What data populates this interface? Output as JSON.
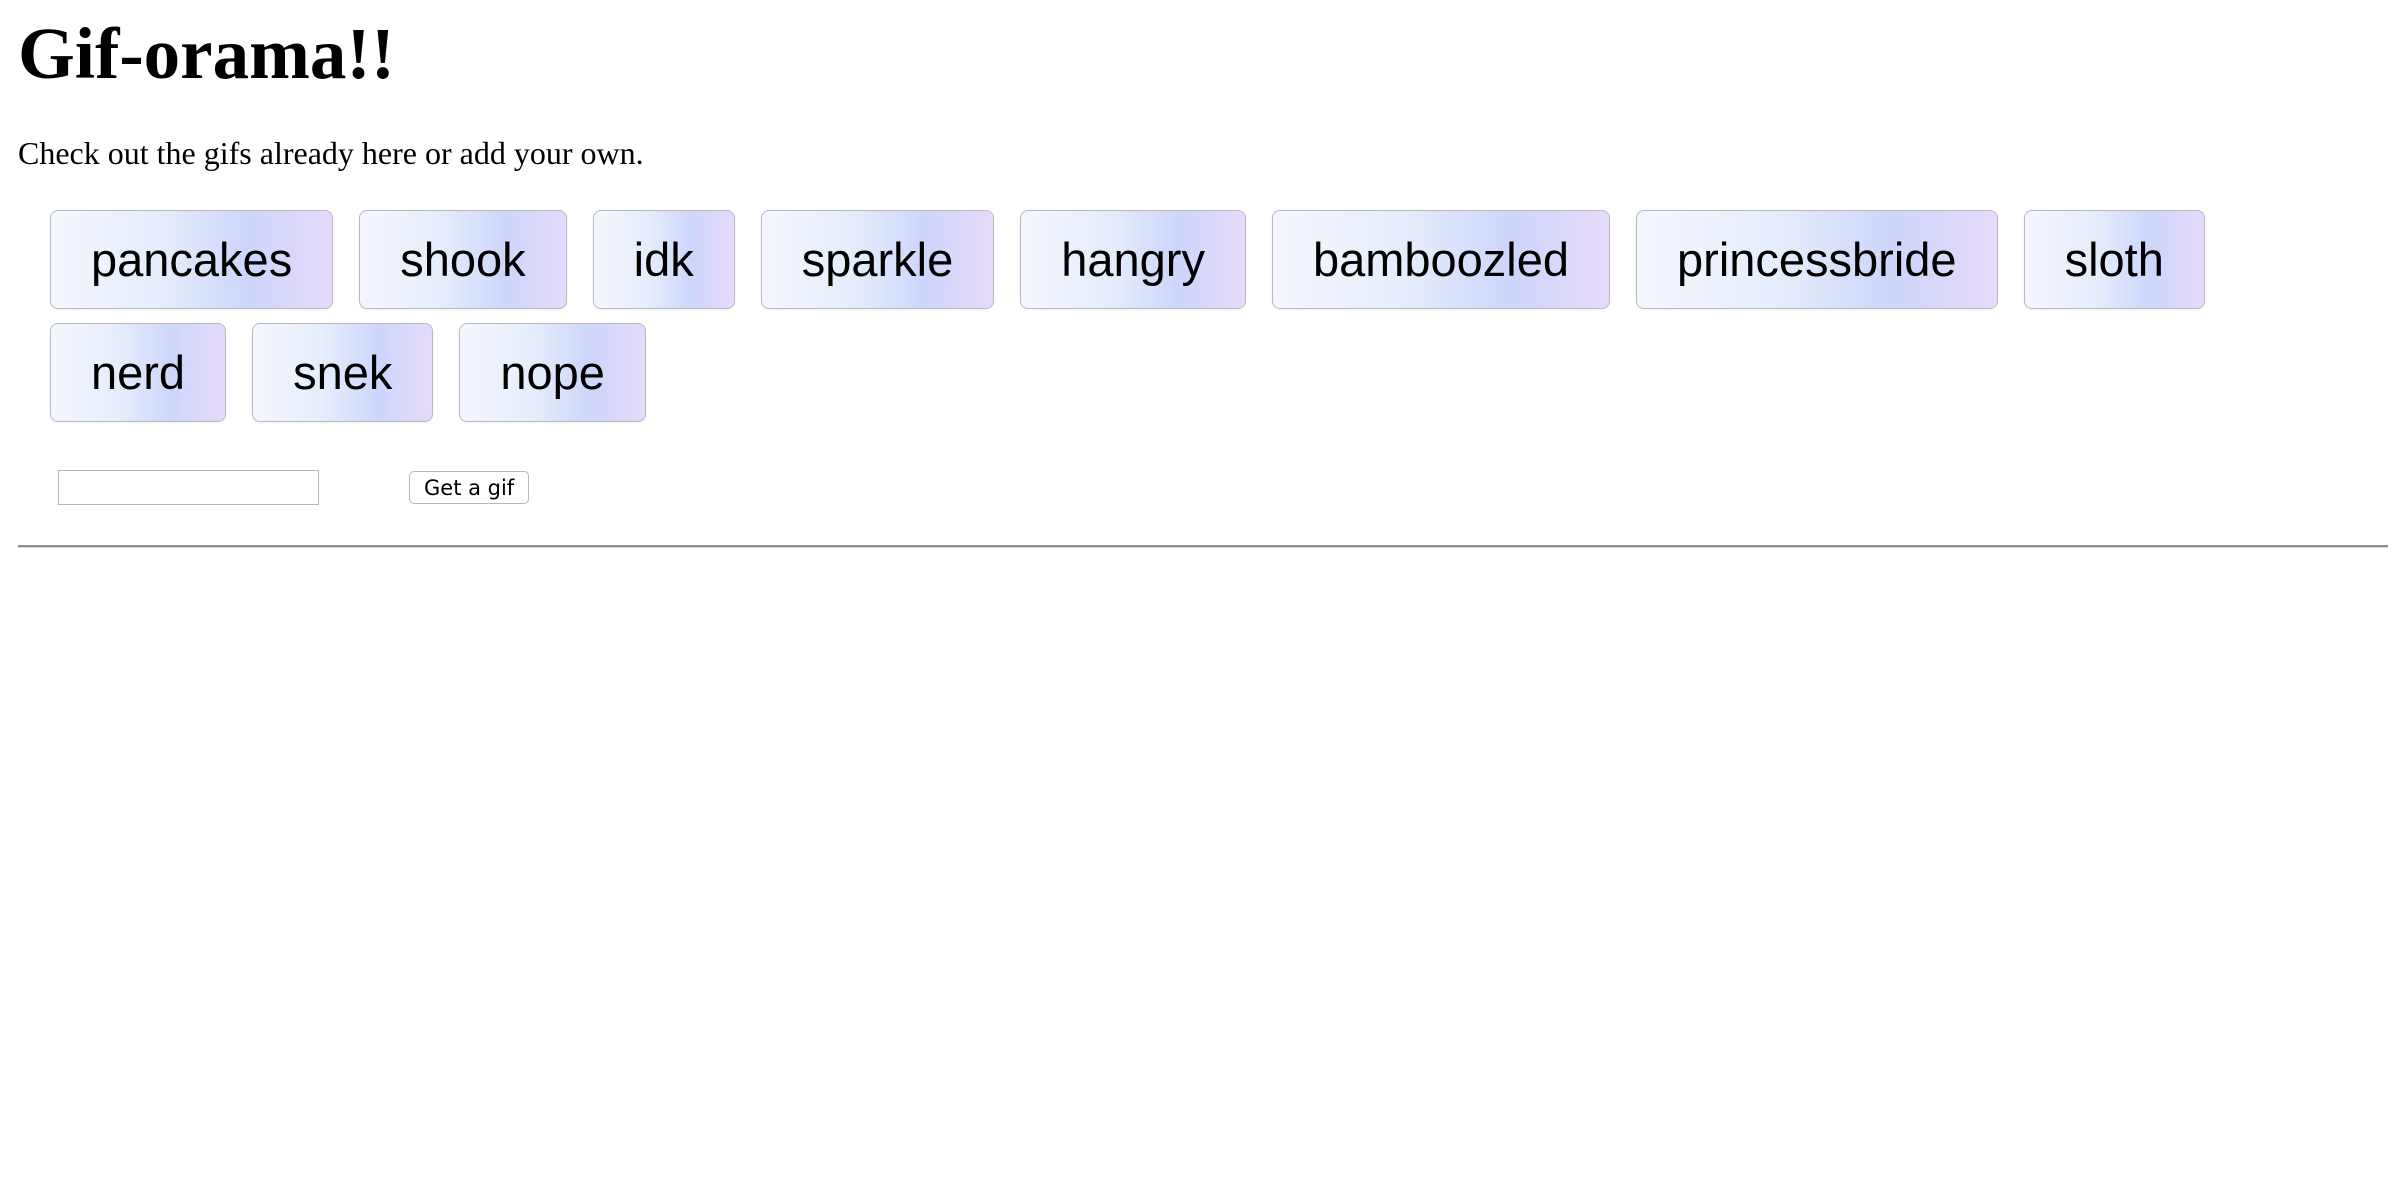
{
  "header": {
    "title": "Gif-orama!!",
    "subtitle": "Check out the gifs already here or add your own."
  },
  "tags": [
    {
      "label": "pancakes"
    },
    {
      "label": "shook"
    },
    {
      "label": "idk"
    },
    {
      "label": "sparkle"
    },
    {
      "label": "hangry"
    },
    {
      "label": "bamboozled"
    },
    {
      "label": "princessbride"
    },
    {
      "label": "sloth"
    },
    {
      "label": "nerd"
    },
    {
      "label": "snek"
    },
    {
      "label": "nope"
    }
  ],
  "form": {
    "input_value": "",
    "input_placeholder": "",
    "submit_label": "Get a gif"
  },
  "colors": {
    "tag_gradient_start": "#f4f7fd",
    "tag_gradient_mid": "#cdd6fb",
    "tag_gradient_end": "#e6dafa",
    "tag_border": "#b9b9c4",
    "divider": "#8c8c8c"
  }
}
